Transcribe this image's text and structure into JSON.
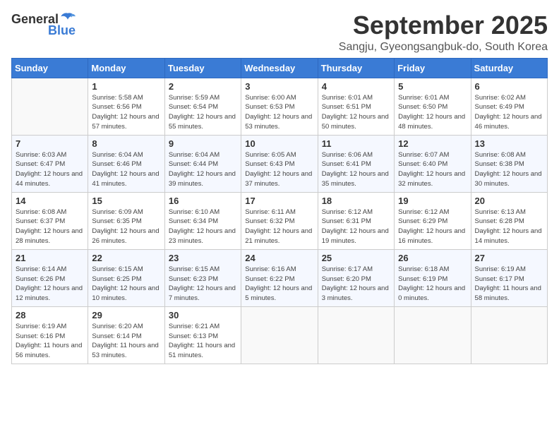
{
  "logo": {
    "general": "General",
    "blue": "Blue"
  },
  "title": "September 2025",
  "location": "Sangju, Gyeongsangbuk-do, South Korea",
  "days_of_week": [
    "Sunday",
    "Monday",
    "Tuesday",
    "Wednesday",
    "Thursday",
    "Friday",
    "Saturday"
  ],
  "weeks": [
    [
      {
        "day": "",
        "sunrise": "",
        "sunset": "",
        "daylight": "",
        "empty": true
      },
      {
        "day": "1",
        "sunrise": "Sunrise: 5:58 AM",
        "sunset": "Sunset: 6:56 PM",
        "daylight": "Daylight: 12 hours and 57 minutes."
      },
      {
        "day": "2",
        "sunrise": "Sunrise: 5:59 AM",
        "sunset": "Sunset: 6:54 PM",
        "daylight": "Daylight: 12 hours and 55 minutes."
      },
      {
        "day": "3",
        "sunrise": "Sunrise: 6:00 AM",
        "sunset": "Sunset: 6:53 PM",
        "daylight": "Daylight: 12 hours and 53 minutes."
      },
      {
        "day": "4",
        "sunrise": "Sunrise: 6:01 AM",
        "sunset": "Sunset: 6:51 PM",
        "daylight": "Daylight: 12 hours and 50 minutes."
      },
      {
        "day": "5",
        "sunrise": "Sunrise: 6:01 AM",
        "sunset": "Sunset: 6:50 PM",
        "daylight": "Daylight: 12 hours and 48 minutes."
      },
      {
        "day": "6",
        "sunrise": "Sunrise: 6:02 AM",
        "sunset": "Sunset: 6:49 PM",
        "daylight": "Daylight: 12 hours and 46 minutes."
      }
    ],
    [
      {
        "day": "7",
        "sunrise": "Sunrise: 6:03 AM",
        "sunset": "Sunset: 6:47 PM",
        "daylight": "Daylight: 12 hours and 44 minutes."
      },
      {
        "day": "8",
        "sunrise": "Sunrise: 6:04 AM",
        "sunset": "Sunset: 6:46 PM",
        "daylight": "Daylight: 12 hours and 41 minutes."
      },
      {
        "day": "9",
        "sunrise": "Sunrise: 6:04 AM",
        "sunset": "Sunset: 6:44 PM",
        "daylight": "Daylight: 12 hours and 39 minutes."
      },
      {
        "day": "10",
        "sunrise": "Sunrise: 6:05 AM",
        "sunset": "Sunset: 6:43 PM",
        "daylight": "Daylight: 12 hours and 37 minutes."
      },
      {
        "day": "11",
        "sunrise": "Sunrise: 6:06 AM",
        "sunset": "Sunset: 6:41 PM",
        "daylight": "Daylight: 12 hours and 35 minutes."
      },
      {
        "day": "12",
        "sunrise": "Sunrise: 6:07 AM",
        "sunset": "Sunset: 6:40 PM",
        "daylight": "Daylight: 12 hours and 32 minutes."
      },
      {
        "day": "13",
        "sunrise": "Sunrise: 6:08 AM",
        "sunset": "Sunset: 6:38 PM",
        "daylight": "Daylight: 12 hours and 30 minutes."
      }
    ],
    [
      {
        "day": "14",
        "sunrise": "Sunrise: 6:08 AM",
        "sunset": "Sunset: 6:37 PM",
        "daylight": "Daylight: 12 hours and 28 minutes."
      },
      {
        "day": "15",
        "sunrise": "Sunrise: 6:09 AM",
        "sunset": "Sunset: 6:35 PM",
        "daylight": "Daylight: 12 hours and 26 minutes."
      },
      {
        "day": "16",
        "sunrise": "Sunrise: 6:10 AM",
        "sunset": "Sunset: 6:34 PM",
        "daylight": "Daylight: 12 hours and 23 minutes."
      },
      {
        "day": "17",
        "sunrise": "Sunrise: 6:11 AM",
        "sunset": "Sunset: 6:32 PM",
        "daylight": "Daylight: 12 hours and 21 minutes."
      },
      {
        "day": "18",
        "sunrise": "Sunrise: 6:12 AM",
        "sunset": "Sunset: 6:31 PM",
        "daylight": "Daylight: 12 hours and 19 minutes."
      },
      {
        "day": "19",
        "sunrise": "Sunrise: 6:12 AM",
        "sunset": "Sunset: 6:29 PM",
        "daylight": "Daylight: 12 hours and 16 minutes."
      },
      {
        "day": "20",
        "sunrise": "Sunrise: 6:13 AM",
        "sunset": "Sunset: 6:28 PM",
        "daylight": "Daylight: 12 hours and 14 minutes."
      }
    ],
    [
      {
        "day": "21",
        "sunrise": "Sunrise: 6:14 AM",
        "sunset": "Sunset: 6:26 PM",
        "daylight": "Daylight: 12 hours and 12 minutes."
      },
      {
        "day": "22",
        "sunrise": "Sunrise: 6:15 AM",
        "sunset": "Sunset: 6:25 PM",
        "daylight": "Daylight: 12 hours and 10 minutes."
      },
      {
        "day": "23",
        "sunrise": "Sunrise: 6:15 AM",
        "sunset": "Sunset: 6:23 PM",
        "daylight": "Daylight: 12 hours and 7 minutes."
      },
      {
        "day": "24",
        "sunrise": "Sunrise: 6:16 AM",
        "sunset": "Sunset: 6:22 PM",
        "daylight": "Daylight: 12 hours and 5 minutes."
      },
      {
        "day": "25",
        "sunrise": "Sunrise: 6:17 AM",
        "sunset": "Sunset: 6:20 PM",
        "daylight": "Daylight: 12 hours and 3 minutes."
      },
      {
        "day": "26",
        "sunrise": "Sunrise: 6:18 AM",
        "sunset": "Sunset: 6:19 PM",
        "daylight": "Daylight: 12 hours and 0 minutes."
      },
      {
        "day": "27",
        "sunrise": "Sunrise: 6:19 AM",
        "sunset": "Sunset: 6:17 PM",
        "daylight": "Daylight: 11 hours and 58 minutes."
      }
    ],
    [
      {
        "day": "28",
        "sunrise": "Sunrise: 6:19 AM",
        "sunset": "Sunset: 6:16 PM",
        "daylight": "Daylight: 11 hours and 56 minutes."
      },
      {
        "day": "29",
        "sunrise": "Sunrise: 6:20 AM",
        "sunset": "Sunset: 6:14 PM",
        "daylight": "Daylight: 11 hours and 53 minutes."
      },
      {
        "day": "30",
        "sunrise": "Sunrise: 6:21 AM",
        "sunset": "Sunset: 6:13 PM",
        "daylight": "Daylight: 11 hours and 51 minutes."
      },
      {
        "day": "",
        "sunrise": "",
        "sunset": "",
        "daylight": "",
        "empty": true
      },
      {
        "day": "",
        "sunrise": "",
        "sunset": "",
        "daylight": "",
        "empty": true
      },
      {
        "day": "",
        "sunrise": "",
        "sunset": "",
        "daylight": "",
        "empty": true
      },
      {
        "day": "",
        "sunrise": "",
        "sunset": "",
        "daylight": "",
        "empty": true
      }
    ]
  ]
}
